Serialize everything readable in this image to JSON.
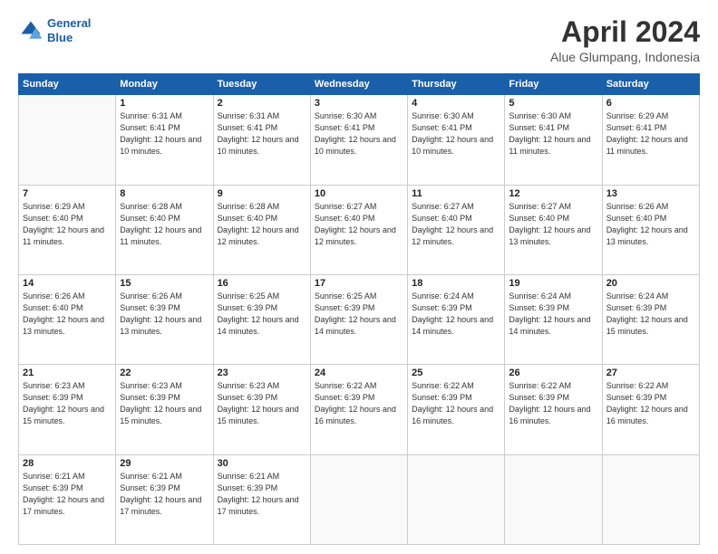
{
  "header": {
    "logo_line1": "General",
    "logo_line2": "Blue",
    "title": "April 2024",
    "subtitle": "Alue Glumpang, Indonesia"
  },
  "days_header": [
    "Sunday",
    "Monday",
    "Tuesday",
    "Wednesday",
    "Thursday",
    "Friday",
    "Saturday"
  ],
  "weeks": [
    [
      {
        "day": "",
        "info": ""
      },
      {
        "day": "1",
        "info": "Sunrise: 6:31 AM\nSunset: 6:41 PM\nDaylight: 12 hours\nand 10 minutes."
      },
      {
        "day": "2",
        "info": "Sunrise: 6:31 AM\nSunset: 6:41 PM\nDaylight: 12 hours\nand 10 minutes."
      },
      {
        "day": "3",
        "info": "Sunrise: 6:30 AM\nSunset: 6:41 PM\nDaylight: 12 hours\nand 10 minutes."
      },
      {
        "day": "4",
        "info": "Sunrise: 6:30 AM\nSunset: 6:41 PM\nDaylight: 12 hours\nand 10 minutes."
      },
      {
        "day": "5",
        "info": "Sunrise: 6:30 AM\nSunset: 6:41 PM\nDaylight: 12 hours\nand 11 minutes."
      },
      {
        "day": "6",
        "info": "Sunrise: 6:29 AM\nSunset: 6:41 PM\nDaylight: 12 hours\nand 11 minutes."
      }
    ],
    [
      {
        "day": "7",
        "info": "Sunrise: 6:29 AM\nSunset: 6:40 PM\nDaylight: 12 hours\nand 11 minutes."
      },
      {
        "day": "8",
        "info": "Sunrise: 6:28 AM\nSunset: 6:40 PM\nDaylight: 12 hours\nand 11 minutes."
      },
      {
        "day": "9",
        "info": "Sunrise: 6:28 AM\nSunset: 6:40 PM\nDaylight: 12 hours\nand 12 minutes."
      },
      {
        "day": "10",
        "info": "Sunrise: 6:27 AM\nSunset: 6:40 PM\nDaylight: 12 hours\nand 12 minutes."
      },
      {
        "day": "11",
        "info": "Sunrise: 6:27 AM\nSunset: 6:40 PM\nDaylight: 12 hours\nand 12 minutes."
      },
      {
        "day": "12",
        "info": "Sunrise: 6:27 AM\nSunset: 6:40 PM\nDaylight: 12 hours\nand 13 minutes."
      },
      {
        "day": "13",
        "info": "Sunrise: 6:26 AM\nSunset: 6:40 PM\nDaylight: 12 hours\nand 13 minutes."
      }
    ],
    [
      {
        "day": "14",
        "info": "Sunrise: 6:26 AM\nSunset: 6:40 PM\nDaylight: 12 hours\nand 13 minutes."
      },
      {
        "day": "15",
        "info": "Sunrise: 6:26 AM\nSunset: 6:39 PM\nDaylight: 12 hours\nand 13 minutes."
      },
      {
        "day": "16",
        "info": "Sunrise: 6:25 AM\nSunset: 6:39 PM\nDaylight: 12 hours\nand 14 minutes."
      },
      {
        "day": "17",
        "info": "Sunrise: 6:25 AM\nSunset: 6:39 PM\nDaylight: 12 hours\nand 14 minutes."
      },
      {
        "day": "18",
        "info": "Sunrise: 6:24 AM\nSunset: 6:39 PM\nDaylight: 12 hours\nand 14 minutes."
      },
      {
        "day": "19",
        "info": "Sunrise: 6:24 AM\nSunset: 6:39 PM\nDaylight: 12 hours\nand 14 minutes."
      },
      {
        "day": "20",
        "info": "Sunrise: 6:24 AM\nSunset: 6:39 PM\nDaylight: 12 hours\nand 15 minutes."
      }
    ],
    [
      {
        "day": "21",
        "info": "Sunrise: 6:23 AM\nSunset: 6:39 PM\nDaylight: 12 hours\nand 15 minutes."
      },
      {
        "day": "22",
        "info": "Sunrise: 6:23 AM\nSunset: 6:39 PM\nDaylight: 12 hours\nand 15 minutes."
      },
      {
        "day": "23",
        "info": "Sunrise: 6:23 AM\nSunset: 6:39 PM\nDaylight: 12 hours\nand 15 minutes."
      },
      {
        "day": "24",
        "info": "Sunrise: 6:22 AM\nSunset: 6:39 PM\nDaylight: 12 hours\nand 16 minutes."
      },
      {
        "day": "25",
        "info": "Sunrise: 6:22 AM\nSunset: 6:39 PM\nDaylight: 12 hours\nand 16 minutes."
      },
      {
        "day": "26",
        "info": "Sunrise: 6:22 AM\nSunset: 6:39 PM\nDaylight: 12 hours\nand 16 minutes."
      },
      {
        "day": "27",
        "info": "Sunrise: 6:22 AM\nSunset: 6:39 PM\nDaylight: 12 hours\nand 16 minutes."
      }
    ],
    [
      {
        "day": "28",
        "info": "Sunrise: 6:21 AM\nSunset: 6:39 PM\nDaylight: 12 hours\nand 17 minutes."
      },
      {
        "day": "29",
        "info": "Sunrise: 6:21 AM\nSunset: 6:39 PM\nDaylight: 12 hours\nand 17 minutes."
      },
      {
        "day": "30",
        "info": "Sunrise: 6:21 AM\nSunset: 6:39 PM\nDaylight: 12 hours\nand 17 minutes."
      },
      {
        "day": "",
        "info": ""
      },
      {
        "day": "",
        "info": ""
      },
      {
        "day": "",
        "info": ""
      },
      {
        "day": "",
        "info": ""
      }
    ]
  ]
}
